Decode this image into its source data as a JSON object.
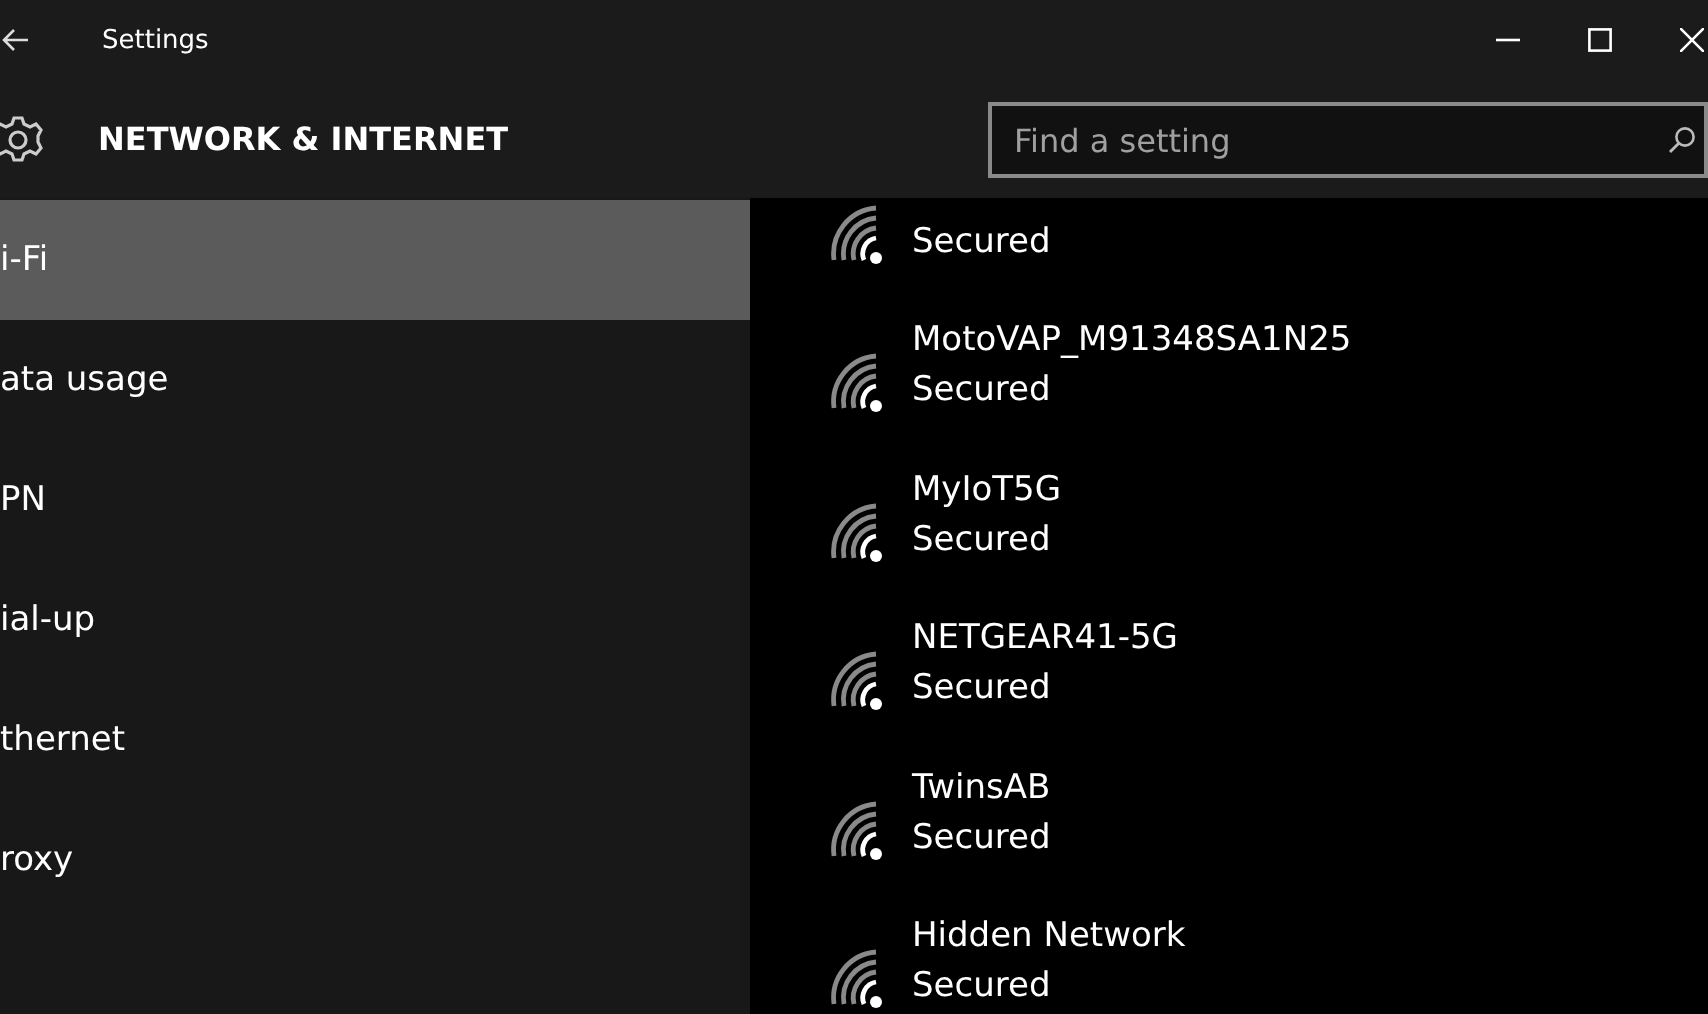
{
  "window": {
    "title": "Settings"
  },
  "header": {
    "title": "NETWORK & INTERNET"
  },
  "search": {
    "placeholder": "Find a setting"
  },
  "sidebar": {
    "items": [
      {
        "label": "i-Fi",
        "selected": true
      },
      {
        "label": "ata usage",
        "selected": false
      },
      {
        "label": "PN",
        "selected": false
      },
      {
        "label": "ial-up",
        "selected": false
      },
      {
        "label": "thernet",
        "selected": false
      },
      {
        "label": "roxy",
        "selected": false
      }
    ]
  },
  "networks": [
    {
      "status": "Secured"
    },
    {
      "name": "MotoVAP_M91348SA1N25",
      "status": "Secured"
    },
    {
      "name": "MyIoT5G",
      "status": "Secured"
    },
    {
      "name": "NETGEAR41-5G",
      "status": "Secured"
    },
    {
      "name": "TwinsAB",
      "status": "Secured"
    },
    {
      "name": "Hidden Network",
      "status": "Secured"
    }
  ]
}
